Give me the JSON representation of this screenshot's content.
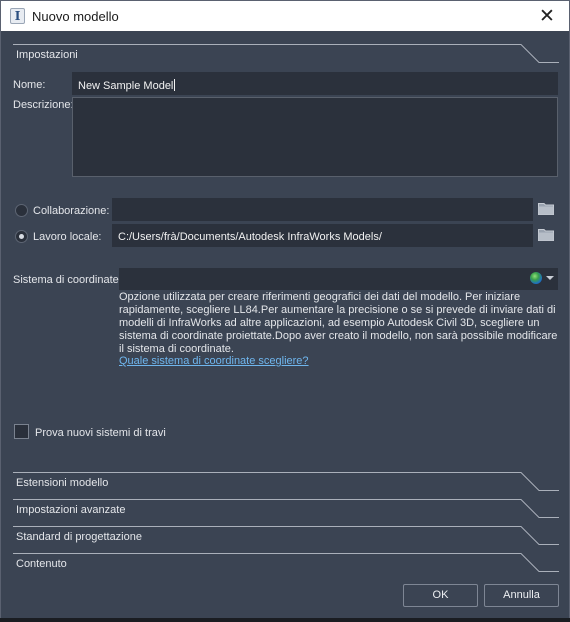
{
  "window": {
    "title": "Nuovo modello",
    "app_icon_glyph": "I",
    "close_glyph": "✕"
  },
  "sections": {
    "settings": "Impostazioni",
    "model_extents": "Estensioni modello",
    "advanced_settings": "Impostazioni avanzate",
    "design_standards": "Standard di progettazione",
    "content": "Contenuto"
  },
  "form": {
    "name_label": "Nome:",
    "name_value": "New Sample Model",
    "description_label": "Descrizione:",
    "description_value": "",
    "collaboration_label": "Collaborazione:",
    "collaboration_value": "",
    "collaboration_selected": false,
    "local_work_label": "Lavoro locale:",
    "local_work_value": "C:/Users/frà/Documents/Autodesk InfraWorks Models/",
    "local_work_selected": true,
    "coord_system_label": "Sistema di coordinate:",
    "coord_system_value": "",
    "coord_system_help": "Opzione utilizzata per creare riferimenti geografici dei dati del modello. Per iniziare rapidamente, scegliere LL84.Per aumentare la precisione o se si prevede di inviare dati di modelli di InfraWorks ad altre applicazioni, ad esempio Autodesk Civil 3D, scegliere un sistema di coordinate proiettate.Dopo aver creato il modello, non sarà possibile modificare il sistema di coordinate.",
    "coord_system_link": "Quale sistema di coordinate scegliere?",
    "try_beam_systems_label": "Prova nuovi sistemi di travi",
    "try_beam_systems_checked": false
  },
  "buttons": {
    "ok": "OK",
    "cancel": "Annulla"
  },
  "icons": {
    "folder": "folder-icon",
    "globe": "globe-icon",
    "close": "close-icon"
  },
  "colors": {
    "dialog_bg": "#3b4453",
    "field_bg": "#2b313c",
    "link": "#6fb6ee",
    "titlebar_bg": "#ffffff"
  }
}
